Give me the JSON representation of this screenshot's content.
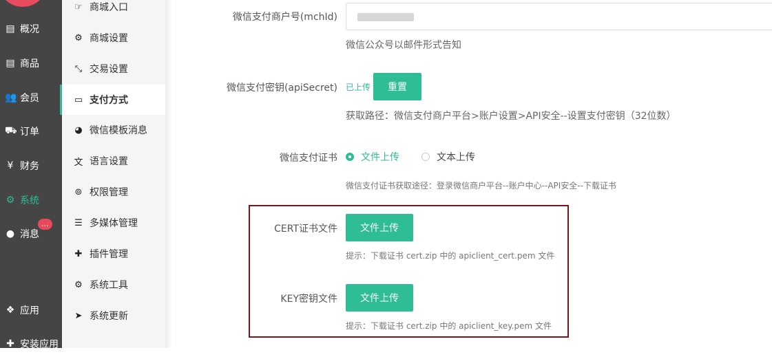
{
  "left_nav": {
    "items": [
      {
        "label": "概况",
        "icon": "archive-icon"
      },
      {
        "label": "商品",
        "icon": "archive-icon"
      },
      {
        "label": "会员",
        "icon": "users-icon"
      },
      {
        "label": "订单",
        "icon": "cart-icon"
      },
      {
        "label": "财务",
        "icon": "yen-icon"
      },
      {
        "label": "系统",
        "icon": "gears-icon"
      },
      {
        "label": "消息",
        "icon": "comment-icon"
      },
      {
        "label": "应用",
        "icon": "cubes-icon"
      },
      {
        "label": "安装应用",
        "icon": "puzzle-icon"
      }
    ],
    "message_badge": "..."
  },
  "sub_menu": {
    "items": [
      {
        "label": "商城入口",
        "icon": "hand-pointer-icon"
      },
      {
        "label": "商城设置",
        "icon": "gear-icon"
      },
      {
        "label": "交易设置",
        "icon": "compress-icon"
      },
      {
        "label": "支付方式",
        "icon": "credit-card-icon"
      },
      {
        "label": "微信模板消息",
        "icon": "wechat-icon"
      },
      {
        "label": "语言设置",
        "icon": "language-icon"
      },
      {
        "label": "权限管理",
        "icon": "gamepad-icon"
      },
      {
        "label": "多媒体管理",
        "icon": "list-icon"
      },
      {
        "label": "插件管理",
        "icon": "puzzle-icon"
      },
      {
        "label": "系统工具",
        "icon": "gear-icon"
      },
      {
        "label": "系统更新",
        "icon": "paper-plane-icon"
      }
    ]
  },
  "form": {
    "mchid_label": "微信支付商户号(mchId)",
    "mchid_help": "微信公众号以邮件形式告知",
    "secret_label": "微信支付密钥(apiSecret)",
    "secret_status": "已上传",
    "reset_button": "重置",
    "secret_help": "获取路径：微信支付商户平台>账户设置>API安全--设置支付密钥（32位数）",
    "cert_label": "微信支付证书",
    "radio_file": "文件上传",
    "radio_text": "文本上传",
    "cert_help": "微信支付证书获取途径：登录微信商户平台--账户中心--API安全--下载证书",
    "cert_file_label": "CERT证书文件",
    "cert_upload_button": "文件上传",
    "cert_file_help": "提示：下载证书 cert.zip 中的 apiclient_cert.pem 文件",
    "key_file_label": "KEY密钥文件",
    "key_upload_button": "文件上传",
    "key_file_help": "提示：下载证书 cert.zip 中的 apiclient_key.pem 文件"
  },
  "colors": {
    "accent": "#2ebd94",
    "nav_bg": "#454545",
    "highlight_border": "#7b1416",
    "badge": "#e8495a"
  }
}
